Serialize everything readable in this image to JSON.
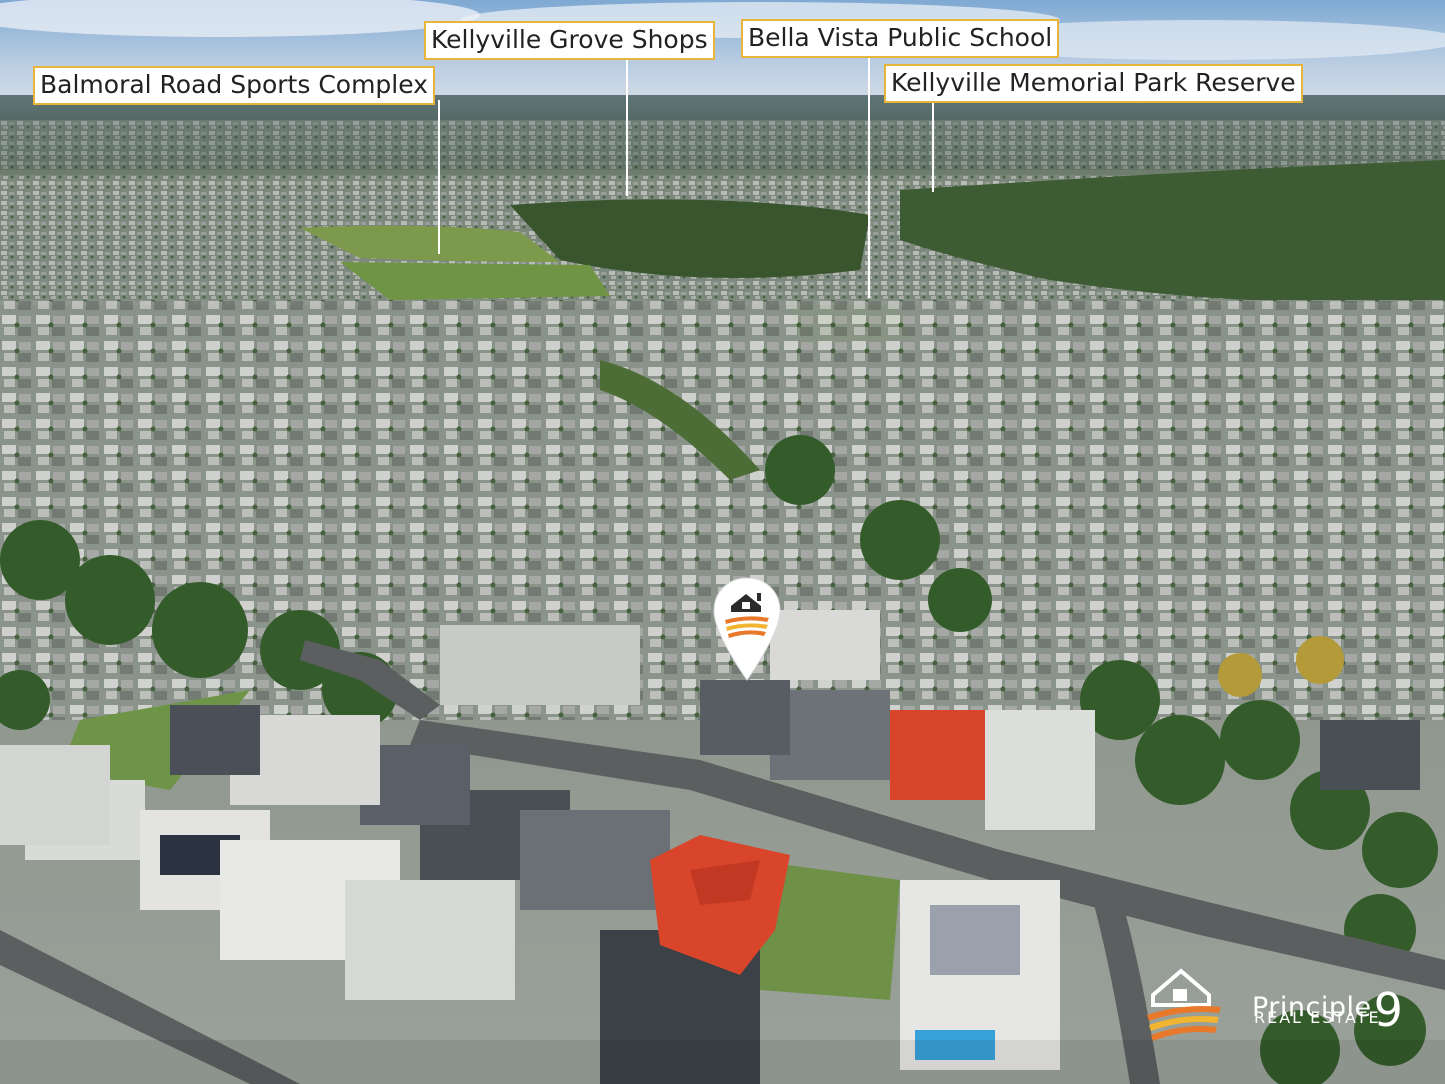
{
  "callouts": {
    "balmoral": "Balmoral Road Sports Complex",
    "grove_shops": "Kellyville Grove Shops",
    "bella_vista": "Bella Vista Public School",
    "memorial_park": "Kellyville Memorial Park Reserve"
  },
  "branding": {
    "name": "Principle",
    "number": "9",
    "subtitle": "REAL ESTATE"
  },
  "marker": {
    "icon": "house-location-pin-icon"
  },
  "colors": {
    "callout_border": "#e8b53c",
    "pin_orange": "#e8782a",
    "pin_yellow": "#f2b531",
    "roof_red": "#d8452a"
  }
}
